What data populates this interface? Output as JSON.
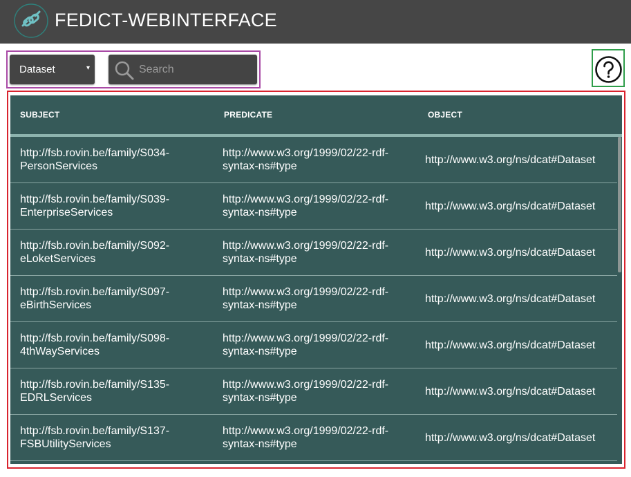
{
  "header": {
    "title": "FEDICT-WEBINTERFACE",
    "logo_icon": "chain-link-icon"
  },
  "toolbar": {
    "type_select": {
      "selected": "Dataset",
      "caret": "▾"
    },
    "search": {
      "placeholder": "Search",
      "value": "",
      "icon": "search-icon"
    },
    "help_icon": "question-mark-circle-icon"
  },
  "table": {
    "columns": [
      "SUBJECT",
      "PREDICATE",
      "OBJECT"
    ],
    "rows": [
      {
        "subject": "http://fsb.rovin.be/family/S034-PersonServices",
        "predicate": "http://www.w3.org/1999/02/22-rdf-syntax-ns#type",
        "object": "http://www.w3.org/ns/dcat#Dataset"
      },
      {
        "subject": "http://fsb.rovin.be/family/S039-EnterpriseServices",
        "predicate": "http://www.w3.org/1999/02/22-rdf-syntax-ns#type",
        "object": "http://www.w3.org/ns/dcat#Dataset"
      },
      {
        "subject": "http://fsb.rovin.be/family/S092-eLoketServices",
        "predicate": "http://www.w3.org/1999/02/22-rdf-syntax-ns#type",
        "object": "http://www.w3.org/ns/dcat#Dataset"
      },
      {
        "subject": "http://fsb.rovin.be/family/S097-eBirthServices",
        "predicate": "http://www.w3.org/1999/02/22-rdf-syntax-ns#type",
        "object": "http://www.w3.org/ns/dcat#Dataset"
      },
      {
        "subject": "http://fsb.rovin.be/family/S098-4thWayServices",
        "predicate": "http://www.w3.org/1999/02/22-rdf-syntax-ns#type",
        "object": "http://www.w3.org/ns/dcat#Dataset"
      },
      {
        "subject": "http://fsb.rovin.be/family/S135-EDRLServices",
        "predicate": "http://www.w3.org/1999/02/22-rdf-syntax-ns#type",
        "object": "http://www.w3.org/ns/dcat#Dataset"
      },
      {
        "subject": "http://fsb.rovin.be/family/S137-FSBUtilityServices",
        "predicate": "http://www.w3.org/1999/02/22-rdf-syntax-ns#type",
        "object": "http://www.w3.org/ns/dcat#Dataset"
      }
    ]
  },
  "colors": {
    "header_bg": "#464646",
    "table_bg": "#365a59",
    "header_divider": "#8db3ae",
    "control_bg": "#444444"
  }
}
